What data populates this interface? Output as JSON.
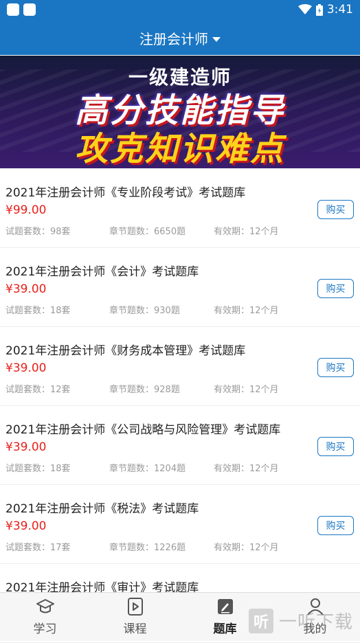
{
  "status_bar": {
    "time": "3:41"
  },
  "header": {
    "title": "注册会计师"
  },
  "banner": {
    "subtitle": "一级建造师",
    "line1": "高分技能指导",
    "line2": "攻克知识难点",
    "slide_count": 2,
    "active_slide": 1
  },
  "products": [
    {
      "title": "2021年注册会计师《专业阶段考试》考试题库",
      "price": "¥99.00",
      "sets": "试题套数：98套",
      "chapters": "章节题数：6650题",
      "validity": "有效期：12个月",
      "buy": "购买"
    },
    {
      "title": "2021年注册会计师《会计》考试题库",
      "price": "¥39.00",
      "sets": "试题套数：18套",
      "chapters": "章节题数：930题",
      "validity": "有效期：12个月",
      "buy": "购买"
    },
    {
      "title": "2021年注册会计师《财务成本管理》考试题库",
      "price": "¥39.00",
      "sets": "试题套数：12套",
      "chapters": "章节题数：928题",
      "validity": "有效期：12个月",
      "buy": "购买"
    },
    {
      "title": "2021年注册会计师《公司战略与风险管理》考试题库",
      "price": "¥39.00",
      "sets": "试题套数：18套",
      "chapters": "章节题数：1204题",
      "validity": "有效期：12个月",
      "buy": "购买"
    },
    {
      "title": "2021年注册会计师《税法》考试题库",
      "price": "¥39.00",
      "sets": "试题套数：17套",
      "chapters": "章节题数：1226题",
      "validity": "有效期：12个月",
      "buy": "购买"
    },
    {
      "title": "2021年注册会计师《审计》考试题库",
      "price": "",
      "sets": "",
      "chapters": "",
      "validity": "",
      "buy": ""
    }
  ],
  "bottom_nav": [
    {
      "label": "学习",
      "icon": "graduation-cap-icon"
    },
    {
      "label": "课程",
      "icon": "play-video-icon"
    },
    {
      "label": "题库",
      "icon": "edit-pen-icon",
      "active": true
    },
    {
      "label": "我的",
      "icon": "person-icon"
    }
  ],
  "watermark": {
    "logo": "听",
    "text": "一听下载"
  },
  "colors": {
    "primary": "#1a76c2",
    "price": "#e7201a",
    "meta": "#9a9a9a"
  }
}
